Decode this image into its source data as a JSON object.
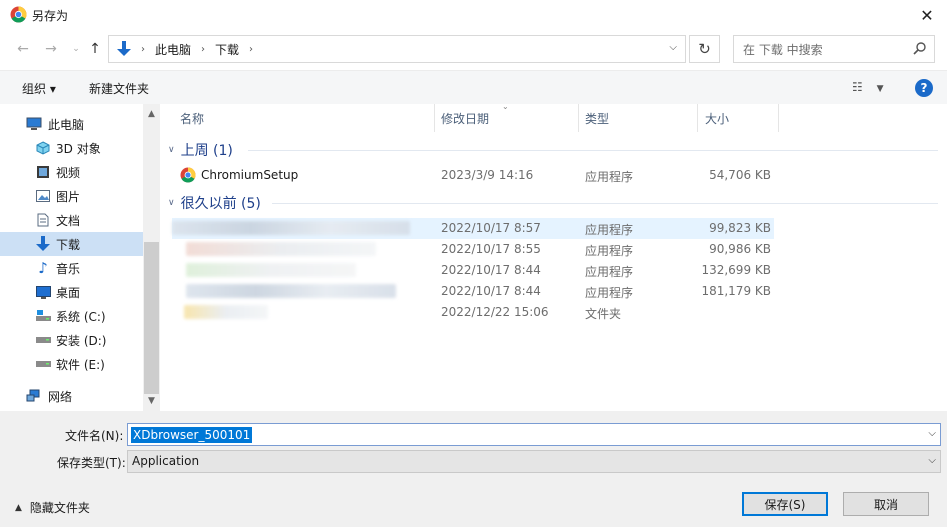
{
  "window": {
    "title": "另存为",
    "close_glyph": "✕"
  },
  "address": {
    "crumbs": [
      "此电脑",
      "下载"
    ],
    "search_placeholder": "在 下载 中搜索"
  },
  "toolbar": {
    "organize": "组织 ▾",
    "new_folder": "新建文件夹",
    "help": "?"
  },
  "nav": {
    "items": [
      {
        "label": "此电脑",
        "icon": "computer-icon"
      },
      {
        "label": "3D 对象",
        "icon": "3d-objects-icon"
      },
      {
        "label": "视频",
        "icon": "video-icon"
      },
      {
        "label": "图片",
        "icon": "pictures-icon"
      },
      {
        "label": "文档",
        "icon": "documents-icon"
      },
      {
        "label": "下载",
        "icon": "download-icon",
        "selected": true
      },
      {
        "label": "音乐",
        "icon": "music-icon"
      },
      {
        "label": "桌面",
        "icon": "desktop-icon"
      },
      {
        "label": "系统 (C:)",
        "icon": "drive-icon"
      },
      {
        "label": "安装 (D:)",
        "icon": "drive-icon"
      },
      {
        "label": "软件 (E:)",
        "icon": "drive-icon"
      },
      {
        "label": "网络",
        "icon": "network-icon"
      }
    ]
  },
  "columns": {
    "name": "名称",
    "date": "修改日期",
    "type": "类型",
    "size": "大小"
  },
  "groups": [
    {
      "label": "上周 (1)",
      "rows": [
        {
          "name": "ChromiumSetup",
          "date": "2023/3/9 14:16",
          "type": "应用程序",
          "size": "54,706 KB"
        }
      ]
    },
    {
      "label": "很久以前 (5)",
      "rows": [
        {
          "name": "",
          "date": "2022/10/17 8:57",
          "type": "应用程序",
          "size": "99,823 KB"
        },
        {
          "name": "",
          "date": "2022/10/17 8:55",
          "type": "应用程序",
          "size": "90,986 KB"
        },
        {
          "name": "",
          "date": "2022/10/17 8:44",
          "type": "应用程序",
          "size": "132,699 KB"
        },
        {
          "name": "",
          "date": "2022/10/17 8:44",
          "type": "应用程序",
          "size": "181,179 KB"
        },
        {
          "name": "",
          "date": "2022/12/22 15:06",
          "type": "文件夹",
          "size": ""
        }
      ]
    }
  ],
  "form": {
    "filename_label": "文件名(N):",
    "filename_value": "XDbrowser_500101",
    "type_label": "保存类型(T):",
    "type_value": "Application"
  },
  "footer": {
    "hide_folders": "隐藏文件夹",
    "save": "保存(S)",
    "cancel": "取消"
  }
}
